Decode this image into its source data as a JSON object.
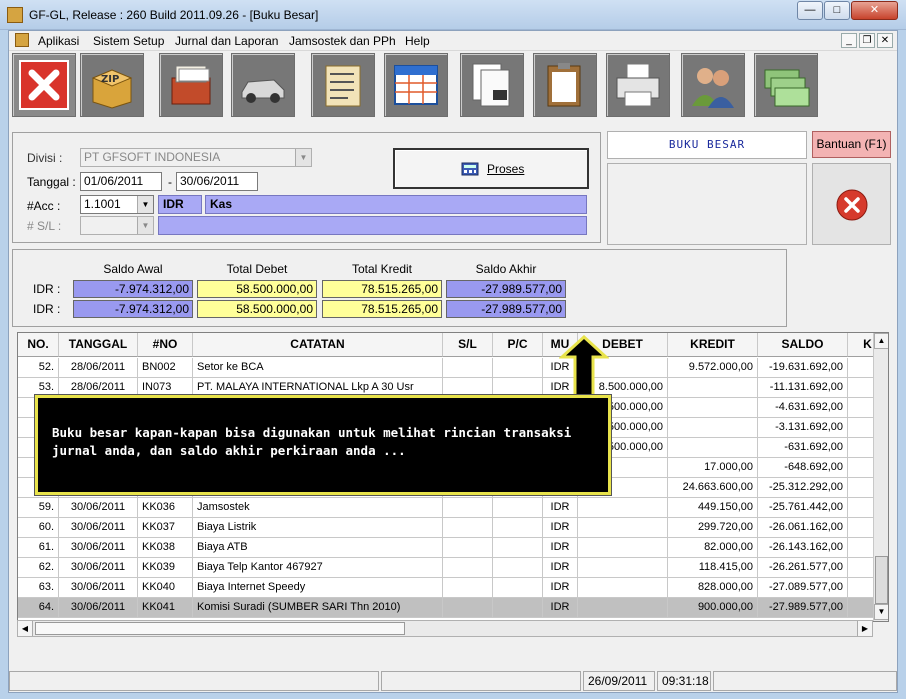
{
  "window": {
    "title": "GF-GL, Release : 260 Build 2011.09.26 - [Buku Besar]",
    "minimize": "0",
    "maximize": "1",
    "close": "r"
  },
  "menu": {
    "items": [
      "Aplikasi",
      "Sistem Setup",
      "Jurnal dan Laporan",
      "Jamsostek dan PPh",
      "Help"
    ]
  },
  "toolbar": {
    "icons": [
      "close-red-x-icon",
      "zip-box-icon",
      "card-file-icon",
      "car-icon",
      "checklist-icon",
      "table-icon",
      "documents-stamp-icon",
      "clipboard-documents-icon",
      "printer-icon",
      "users-icon",
      "money-icon"
    ]
  },
  "filter": {
    "divisi_label": "Divisi :",
    "divisi_value": "PT GFSOFT INDONESIA",
    "tanggal_label": "Tanggal :",
    "date_from": "01/06/2011",
    "date_sep": "-",
    "date_to": "30/06/2011",
    "acc_label": "#Acc :",
    "acc_value": "1.1001",
    "acc_currency": "IDR",
    "acc_name": "Kas",
    "sl_label": "# S/L :",
    "sl_value": "",
    "proses_label": "Proses"
  },
  "right_panel": {
    "title": "BUKU BESAR",
    "help_button": "Bantuan (F1)"
  },
  "summary": {
    "headers": [
      "Saldo Awal",
      "Total Debet",
      "Total Kredit",
      "Saldo Akhir"
    ],
    "rows": [
      {
        "label": "IDR :",
        "values": [
          "-7.974.312,00",
          "58.500.000,00",
          "78.515.265,00",
          "-27.989.577,00"
        ]
      },
      {
        "label": "IDR :",
        "values": [
          "-7.974.312,00",
          "58.500.000,00",
          "78.515.265,00",
          "-27.989.577,00"
        ]
      }
    ]
  },
  "grid": {
    "columns": [
      "NO.",
      "TANGGAL",
      "#NO",
      "CATATAN",
      "S/L",
      "P/C",
      "MU",
      "DEBET",
      "KREDIT",
      "SALDO",
      "K"
    ],
    "rows": [
      [
        "52.",
        "28/06/2011",
        "BN002",
        "Setor ke BCA",
        "",
        "",
        "IDR",
        "",
        "9.572.000,00",
        "-19.631.692,00"
      ],
      [
        "53.",
        "28/06/2011",
        "IN073",
        "PT. MALAYA INTERNATIONAL Lkp A 30 Usr",
        "",
        "",
        "IDR",
        "8.500.000,00",
        "",
        "-11.131.692,00"
      ],
      [
        "",
        "",
        "",
        "",
        "",
        "",
        "",
        ".500.000,00",
        "",
        "-4.631.692,00"
      ],
      [
        "",
        "",
        "",
        "",
        "",
        "",
        "",
        ".500.000,00",
        "",
        "-3.131.692,00"
      ],
      [
        "",
        "",
        "",
        "",
        "",
        "",
        "",
        ".500.000,00",
        "",
        "-631.692,00"
      ],
      [
        "",
        "",
        "",
        "",
        "",
        "",
        "",
        "",
        "17.000,00",
        "-648.692,00"
      ],
      [
        "",
        "",
        "",
        "",
        "",
        "",
        "",
        "",
        "24.663.600,00",
        "-25.312.292,00"
      ],
      [
        "59.",
        "30/06/2011",
        "KK036",
        "Jamsostek",
        "",
        "",
        "IDR",
        "",
        "449.150,00",
        "-25.761.442,00"
      ],
      [
        "60.",
        "30/06/2011",
        "KK037",
        "Biaya Listrik",
        "",
        "",
        "IDR",
        "",
        "299.720,00",
        "-26.061.162,00"
      ],
      [
        "61.",
        "30/06/2011",
        "KK038",
        "Biaya ATB",
        "",
        "",
        "IDR",
        "",
        "82.000,00",
        "-26.143.162,00"
      ],
      [
        "62.",
        "30/06/2011",
        "KK039",
        "Biaya Telp Kantor 467927",
        "",
        "",
        "IDR",
        "",
        "118.415,00",
        "-26.261.577,00"
      ],
      [
        "63.",
        "30/06/2011",
        "KK040",
        "Biaya Internet Speedy",
        "",
        "",
        "IDR",
        "",
        "828.000,00",
        "-27.089.577,00"
      ],
      [
        "64.",
        "30/06/2011",
        "KK041",
        "Komisi Suradi (SUMBER SARI Thn 2010)",
        "",
        "",
        "IDR",
        "",
        "900.000,00",
        "-27.989.577,00"
      ]
    ],
    "selected_row": 12
  },
  "tooltip": {
    "text": "Buku besar kapan-kapan bisa digunakan untuk melihat rincian transaksi jurnal anda, dan saldo akhir perkiraan anda ..."
  },
  "status": {
    "date": "26/09/2011",
    "time": "09:31:18"
  },
  "colors": {
    "purple": "#9999f0",
    "yellow": "#ffff99",
    "tooltip_border": "#e8e34b"
  }
}
